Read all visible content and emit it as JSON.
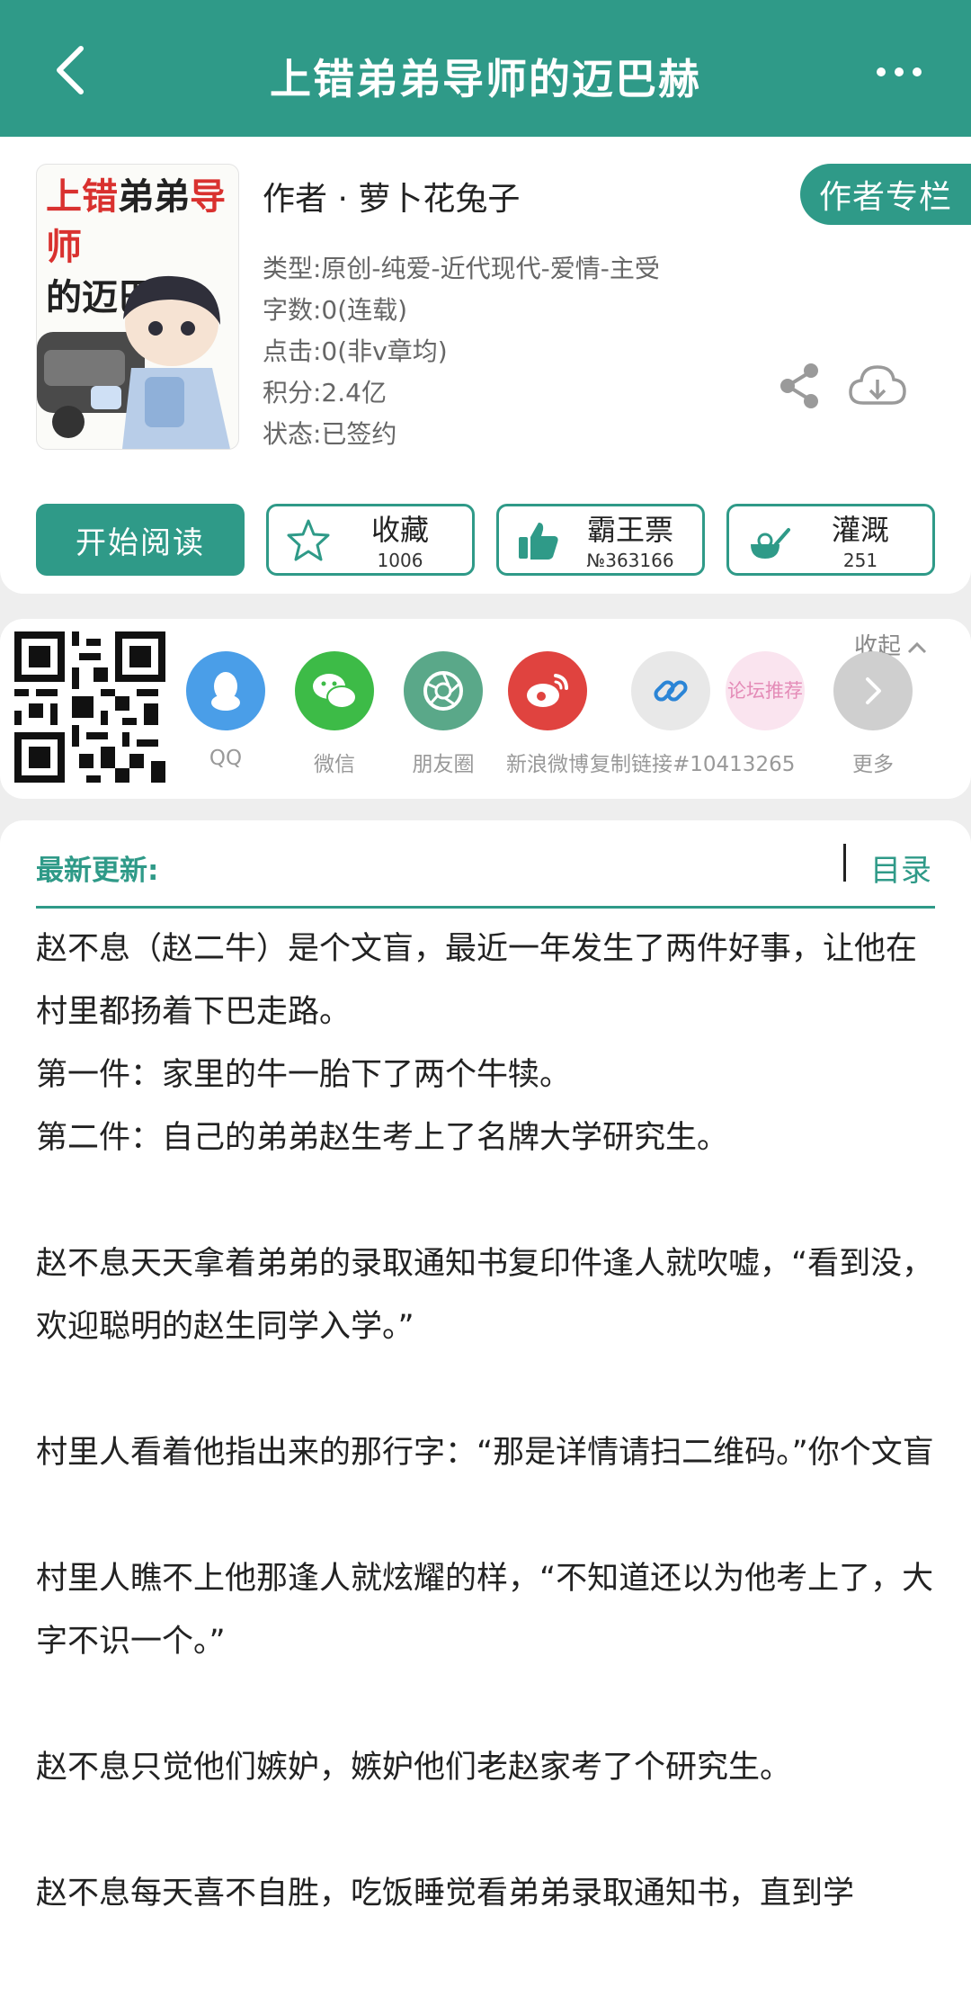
{
  "header": {
    "title": "上错弟弟导师的迈巴赫"
  },
  "book": {
    "cover_title_line1_red": "上错",
    "cover_title_line1_dark": "弟弟",
    "cover_title_line1_red2": "导师",
    "cover_title_line2": "的迈巴赫",
    "author_line": "作者 · 萝卜花兔子",
    "author_column_label": "作者专栏",
    "meta": {
      "genre": "类型:原创-纯爱-近代现代-爱情-主受",
      "words": "字数:0(连载)",
      "clicks": "点击:0(非v章均)",
      "points": "积分:2.4亿",
      "status": "状态:已签约"
    }
  },
  "actions": {
    "read": "开始阅读",
    "favorite": {
      "label": "收藏",
      "count": "1006"
    },
    "vote": {
      "label": "霸王票",
      "count": "№363166"
    },
    "water": {
      "label": "灌溉",
      "count": "251"
    }
  },
  "share": {
    "collapse_label": "收起",
    "items": [
      {
        "label": "QQ",
        "icon": "qq-icon",
        "color": "#4a9ee8"
      },
      {
        "label": "微信",
        "icon": "wechat-icon",
        "color": "#3dbb47"
      },
      {
        "label": "朋友圈",
        "icon": "moments-icon",
        "color": "#5aa889"
      },
      {
        "label": "新浪微博",
        "icon": "weibo-icon",
        "color": "#e0433f"
      },
      {
        "label": "复制链接#10413265",
        "icon": "link-icon",
        "color": "#2b85d6"
      },
      {
        "label": "论坛推荐",
        "icon": "forum-icon",
        "color": "#fae4ef"
      },
      {
        "label": "更多",
        "icon": "chevron-right-icon",
        "color": "#cfcfcf"
      }
    ]
  },
  "content": {
    "latest_label": "最新更新:",
    "toc_label": "目录",
    "paragraphs": [
      "赵不息（赵二牛）是个文盲，最近一年发生了两件好事，让他在村里都扬着下巴走路。",
      "第一件：家里的牛一胎下了两个牛犊。",
      "第二件：自己的弟弟赵生考上了名牌大学研究生。",
      "赵不息天天拿着弟弟的录取通知书复印件逢人就吹嘘，“看到没，欢迎聪明的赵生同学入学。”",
      "村里人看着他指出来的那行字：“那是详情请扫二维码。”你个文盲",
      "村里人瞧不上他那逢人就炫耀的样，“不知道还以为他考上了，大字不识一个。”",
      "赵不息只觉他们嫉妒，嫉妒他们老赵家考了个研究生。",
      "赵不息每天喜不自胜，吃饭睡觉看弟弟录取通知书，直到学"
    ]
  },
  "colors": {
    "brand": "#2f9a88",
    "background": "#eeeeee"
  }
}
